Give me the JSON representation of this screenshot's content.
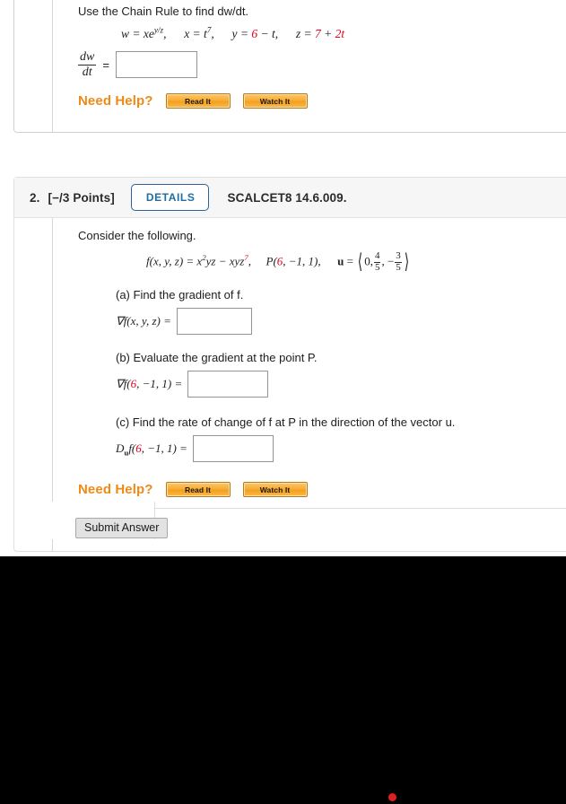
{
  "question1": {
    "prompt": "Use the Chain Rule to find dw/dt.",
    "formula": {
      "w": "w = xe",
      "w_exp": "y/z",
      "comma1": ",",
      "x": "x = t",
      "x_exp": "7",
      "comma2": ",",
      "y_lhs": "y = ",
      "y_val": "6",
      "y_rest": " − t,",
      "z_lhs": "z = ",
      "z_val": "7",
      "z_mid": " + ",
      "z_val2": "2t"
    },
    "answer_label": {
      "numerator": "dw",
      "denominator": "dt",
      "equals": "="
    },
    "answer_value": "",
    "need_help": {
      "label": "Need Help?",
      "read_it": "Read It",
      "watch_it": "Watch It"
    }
  },
  "question2": {
    "header": {
      "number": "2.",
      "points": "[−/3 Points]",
      "details": "DETAILS",
      "code": "SCALCET8 14.6.009."
    },
    "prompt": "Consider the following.",
    "function": {
      "lhs": "f(x, y, z) = x",
      "lhs_exp": "2",
      "lhs_mid": "yz − xyz",
      "lhs_exp2": "7",
      "comma": ",",
      "point_lhs": "P(",
      "point_val": "6",
      "point_rest": ", −1, 1),",
      "u_label": "u",
      "u_equals": "=",
      "u_first": "0,",
      "u_f1_num": "4",
      "u_f1_den": "5",
      "u_sep": ", −",
      "u_f2_num": "3",
      "u_f2_den": "5"
    },
    "parts": [
      {
        "label": "(a) Find the gradient of f.",
        "answer_label_pre": "∇f(x, y, z) =",
        "answer_value": ""
      },
      {
        "label": "(b) Evaluate the gradient at the point P.",
        "answer_label_pre": "∇f(",
        "answer_label_red": "6",
        "answer_label_post": ", −1, 1) =",
        "answer_value": ""
      },
      {
        "label": "(c) Find the rate of change of f at P in the direction of the vector u.",
        "answer_label_pre": "D",
        "answer_label_sub": "u",
        "answer_label_mid": "f(",
        "answer_label_red": "6",
        "answer_label_post": ", −1, 1) =",
        "answer_value": ""
      }
    ],
    "need_help": {
      "label": "Need Help?",
      "read_it": "Read It",
      "watch_it": "Watch It"
    },
    "submit": "Submit Answer"
  },
  "colors": {
    "accent_orange": "#f08a16",
    "link_blue": "#1c6ea4",
    "highlight_red": "#e8001d",
    "header_band": "#f6f6f6"
  }
}
